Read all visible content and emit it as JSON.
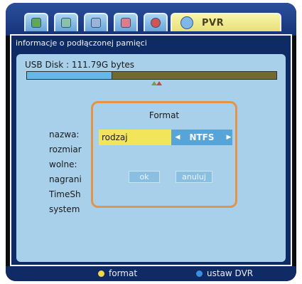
{
  "tabs": [
    {
      "icon": "tv-icon"
    },
    {
      "icon": "antenna-icon"
    },
    {
      "icon": "tools-icon"
    },
    {
      "icon": "heart-icon"
    },
    {
      "icon": "game-icon"
    },
    {
      "icon": "disc-icon",
      "label": "PVR",
      "active": true
    }
  ],
  "header": {
    "title": "informacje o podłączonej pamięci"
  },
  "storage": {
    "disk_text": "USB Disk : 111.79G bytes",
    "used_fraction": 0.34
  },
  "info_labels": [
    "nazwa:",
    "rozmiar",
    "wolne:",
    "nagrani",
    "TimeSh",
    "system"
  ],
  "dialog": {
    "title": "Format",
    "field_label": "rodzaj",
    "field_value": "NTFS",
    "ok_label": "ok",
    "cancel_label": "anuluj"
  },
  "footer": {
    "yellow_label": "format",
    "blue_label": "ustaw DVR",
    "yellow_color": "#f2d64a",
    "blue_color": "#3a8fe0"
  }
}
